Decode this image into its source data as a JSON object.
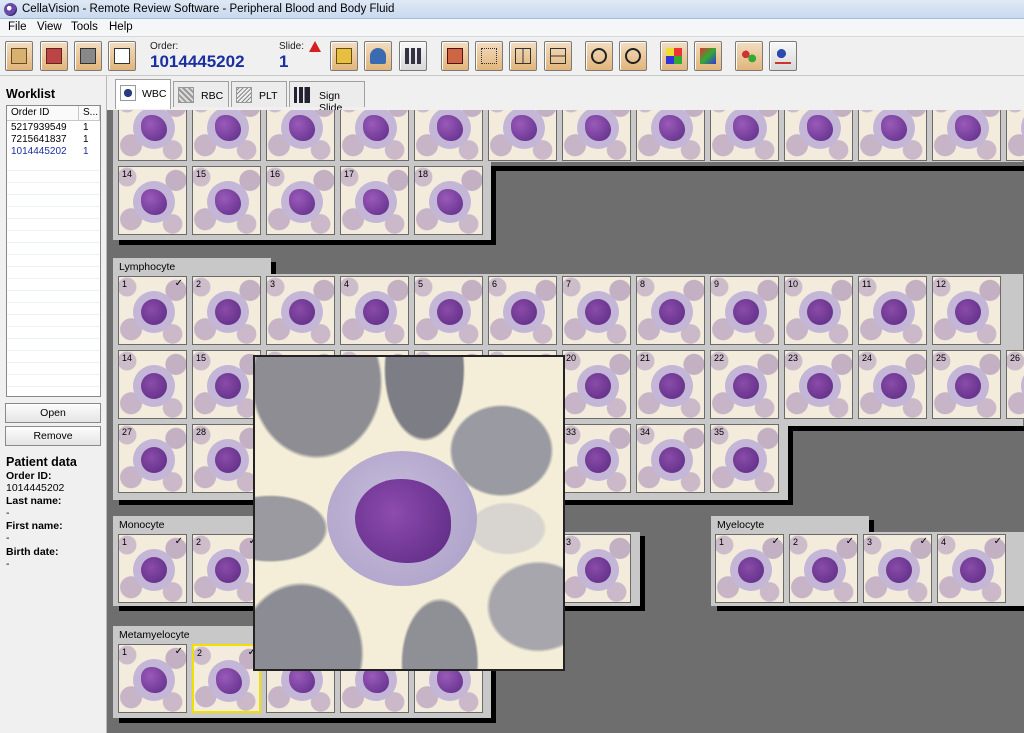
{
  "window": {
    "title": "CellaVision - Remote Review Software - Peripheral Blood and Body Fluid"
  },
  "menu": [
    "File",
    "View",
    "Tools",
    "Help"
  ],
  "toolbar": {
    "order_label": "Order:",
    "order_value": "1014445202",
    "slide_label": "Slide:",
    "slide_value": "1",
    "buttons": [
      "open-icon",
      "worklist-icon",
      "remove-icon",
      "report-icon",
      "export-icon",
      "person-icon",
      "chart-icon",
      "slide-view-icon",
      "grid-small-icon",
      "grid-medium-icon",
      "grid-large-icon",
      "zoom-in-icon",
      "zoom-out-icon",
      "color-icon",
      "refresh-icon",
      "cells-icon",
      "info-icon"
    ]
  },
  "worklist": {
    "title": "Worklist",
    "columns": [
      "Order ID",
      "S..."
    ],
    "rows": [
      {
        "order_id": "5217939549",
        "slide": "1"
      },
      {
        "order_id": "7215641837",
        "slide": "1"
      },
      {
        "order_id": "1014445202",
        "slide": "1"
      }
    ],
    "open_label": "Open",
    "remove_label": "Remove"
  },
  "patient": {
    "title": "Patient data",
    "order_id_label": "Order ID:",
    "order_id_value": "1014445202",
    "last_name_label": "Last name:",
    "last_name_value": "-",
    "first_name_label": "First name:",
    "first_name_value": "-",
    "birth_date_label": "Birth date:",
    "birth_date_value": "-"
  },
  "tabs": [
    {
      "label": "WBC",
      "active": true
    },
    {
      "label": "RBC",
      "active": false
    },
    {
      "label": "PLT",
      "active": false
    },
    {
      "label": "Sign Slide",
      "active": false
    }
  ],
  "groups": {
    "neutrophil_row2": [
      "14",
      "15",
      "16",
      "17",
      "18"
    ],
    "lymphocyte": {
      "label": "Lymphocyte",
      "row1": [
        "1",
        "2",
        "3",
        "4",
        "5",
        "6",
        "7",
        "8",
        "9",
        "10",
        "11",
        "12"
      ],
      "row2": [
        "14",
        "15",
        "",
        "",
        "",
        "",
        "20",
        "21",
        "22",
        "23",
        "24",
        "25",
        "26"
      ],
      "row3": [
        "27",
        "28",
        "",
        "",
        "",
        "",
        "33",
        "34",
        "35"
      ]
    },
    "monocyte": {
      "label": "Monocyte",
      "cells": [
        "1",
        "2",
        "3"
      ]
    },
    "myelocyte": {
      "label": "Myelocyte",
      "cells": [
        "1",
        "2",
        "3",
        "4"
      ]
    },
    "metamyelocyte": {
      "label": "Metamyelocyte",
      "cells": [
        "1",
        "2"
      ]
    }
  }
}
